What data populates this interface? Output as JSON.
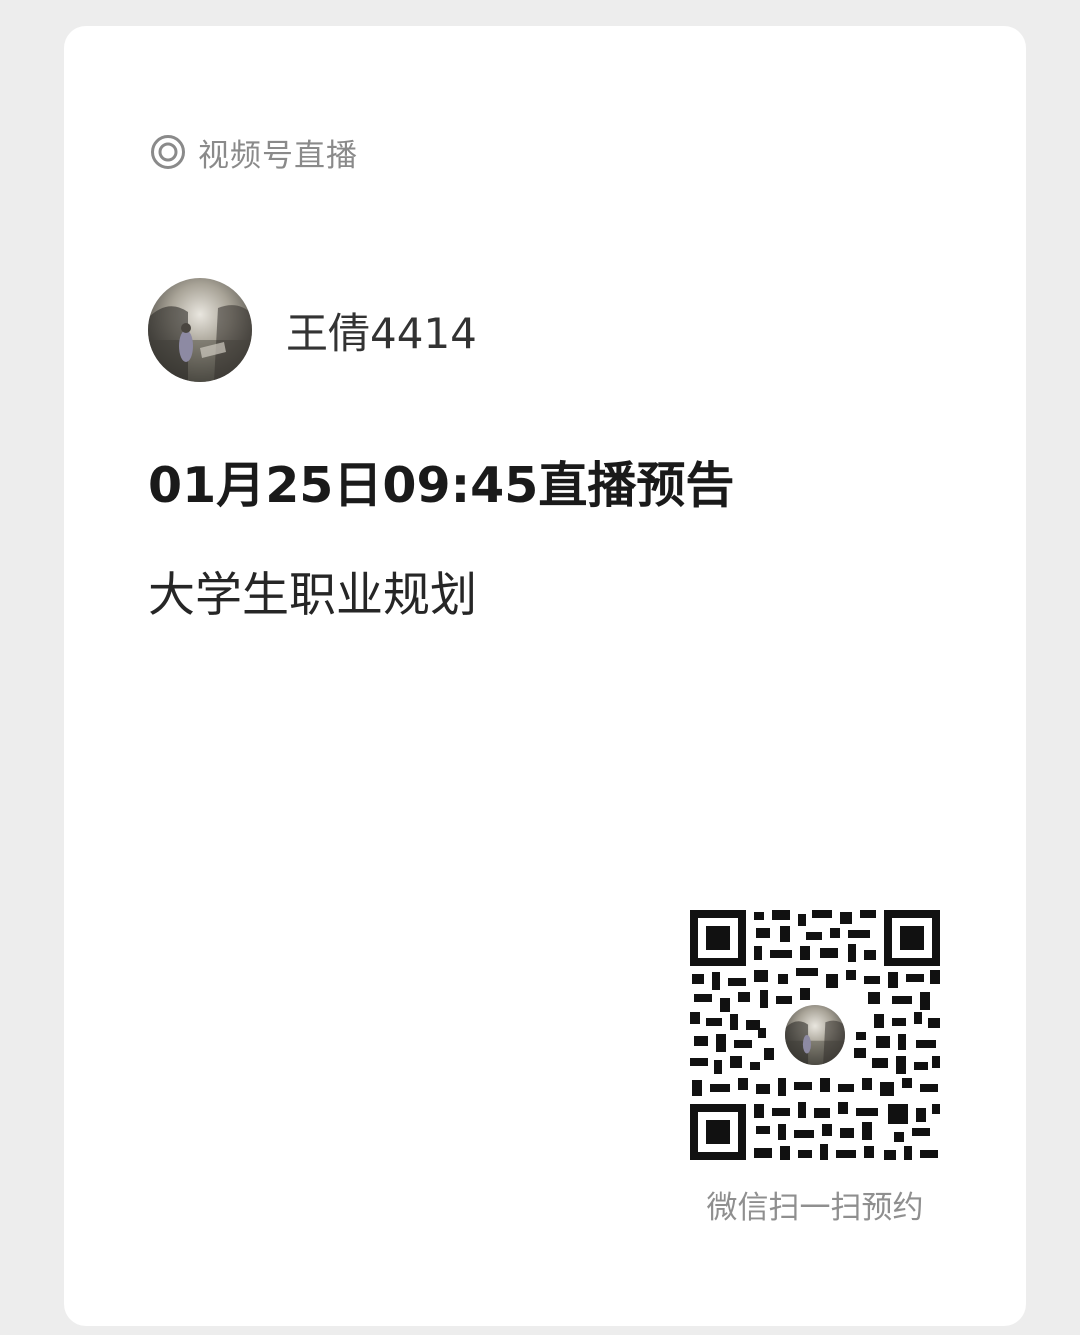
{
  "channel": {
    "icon": "channels-icon",
    "label": "视频号直播"
  },
  "author": {
    "name": "王倩4414"
  },
  "announcement": {
    "text": "01月25日09:45直播预告"
  },
  "live": {
    "title": "大学生职业规划"
  },
  "qr": {
    "caption": "微信扫一扫预约"
  },
  "colors": {
    "background": "#ededed",
    "card": "#ffffff",
    "muted_text": "#8a8a8a",
    "primary_text": "#1a1a1a"
  }
}
